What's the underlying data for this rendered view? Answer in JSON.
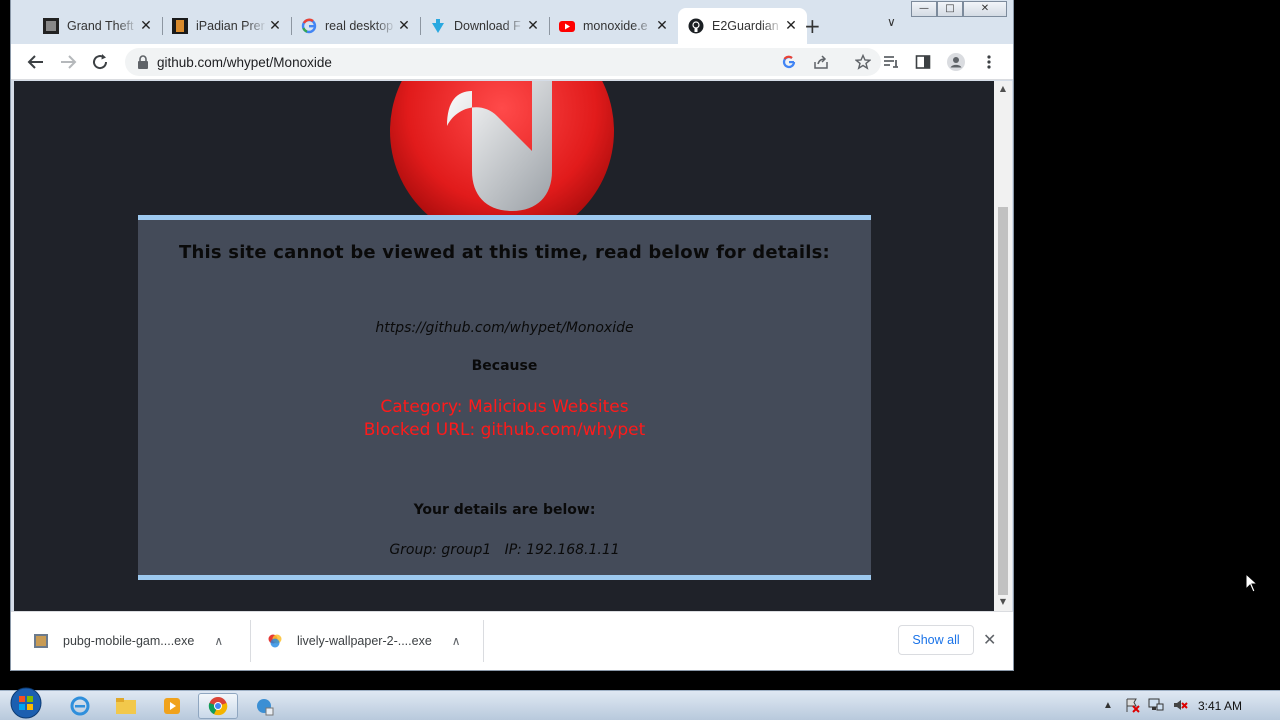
{
  "browser": {
    "tabs": [
      {
        "title": "Grand Theft",
        "icon": "gta-favicon",
        "active": false
      },
      {
        "title": "iPadian Prer",
        "icon": "ipadian-favicon",
        "active": false
      },
      {
        "title": "real desktop",
        "icon": "google-favicon",
        "active": false
      },
      {
        "title": "Download F",
        "icon": "download-favicon",
        "active": false
      },
      {
        "title": "monoxide.e",
        "icon": "youtube-favicon",
        "active": false
      },
      {
        "title": "E2Guardian",
        "icon": "github-favicon",
        "active": true
      }
    ],
    "url": "github.com/whypet/Monoxide"
  },
  "block_page": {
    "title": "This site cannot be viewed at this time, read below for details:",
    "blocked_url": "https://github.com/whypet/Monoxide",
    "because": "Because",
    "category": "Category: Malicious Websites",
    "blocked_url_reason": "Blocked URL: github.com/whypet",
    "details_heading": "Your details are below:",
    "details": "Group: group1   IP: 192.168.1.11"
  },
  "downloads": [
    {
      "name": "pubg-mobile-gam....exe",
      "icon": "pubg-file-icon"
    },
    {
      "name": "lively-wallpaper-2-....exe",
      "icon": "lively-file-icon"
    }
  ],
  "downloads_show_all": "Show all",
  "taskbar": {
    "clock": "3:41 AM"
  },
  "colors": {
    "page_bg": "#1f2229",
    "panel_bg": "#444b59",
    "panel_border": "#9dc9ef",
    "reason_text": "#ff1a1a"
  }
}
